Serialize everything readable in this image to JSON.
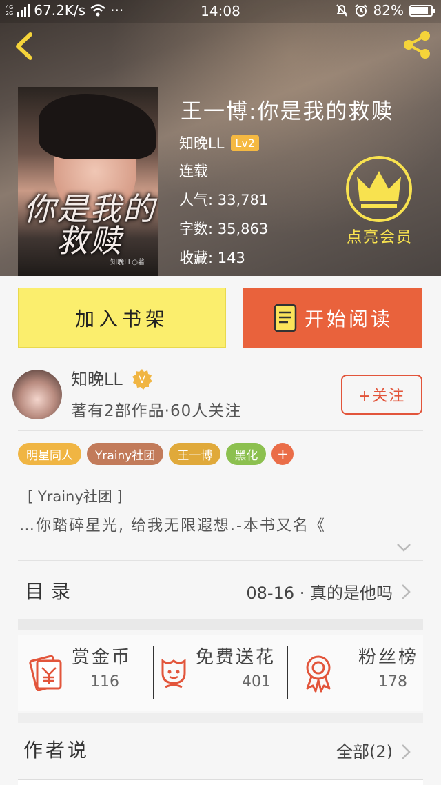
{
  "status_bar": {
    "net_top": "4G",
    "net_bottom": "2G",
    "speed": "67.2K/s",
    "dots": "···",
    "time": "14:08",
    "battery": "82%"
  },
  "book": {
    "title": "王一博:你是我的救赎",
    "cover_title": "你是我的救赎",
    "cover_signature": "知晚LL○著",
    "author": "知晚LL",
    "level": "Lv2",
    "status": "连载",
    "popularity": "人气: 33,781",
    "words": "字数: 35,863",
    "favorites": "收藏: 143"
  },
  "vip": {
    "label": "点亮会员"
  },
  "actions": {
    "shelf": "加入书架",
    "read": "开始阅读"
  },
  "author_card": {
    "name": "知晚LL",
    "verified_badge": "V",
    "stats": "著有2部作品·60人关注",
    "follow": "+关注"
  },
  "tags": [
    {
      "label": "明星同人",
      "color": "#f0b543"
    },
    {
      "label": "Yrainy社团",
      "color": "#c27b5a"
    },
    {
      "label": "王一博",
      "color": "#e0a93a"
    },
    {
      "label": "黑化",
      "color": "#8cc04f"
    }
  ],
  "tag_add": "+",
  "intro": {
    "line1": "[ Yrainy社团 ]",
    "line2": "…你踏碎星光, 给我无限遐想.-本书又名《"
  },
  "catalog": {
    "label": "目录",
    "latest": "08-16 · 真的是他吗"
  },
  "stats": {
    "coins": {
      "label": "赏金币",
      "value": "116"
    },
    "flowers": {
      "label": "免费送花",
      "value": "401"
    },
    "fans": {
      "label": "粉丝榜",
      "value": "178"
    }
  },
  "author_say": {
    "label": "作者说",
    "all": "全部(2)"
  },
  "icons": {
    "back": "back-arrow-icon",
    "share": "share-icon",
    "crown": "crown-icon",
    "book": "book-icon",
    "expand": "chevron-down-icon",
    "coins": "red-envelope-icon",
    "flowers": "flower-icon",
    "fans": "medal-icon"
  },
  "colors": {
    "accent_yellow": "#fbee6d",
    "accent_orange": "#e9623c",
    "vip_yellow": "#f8e24f",
    "icon_red": "#e2553b"
  }
}
